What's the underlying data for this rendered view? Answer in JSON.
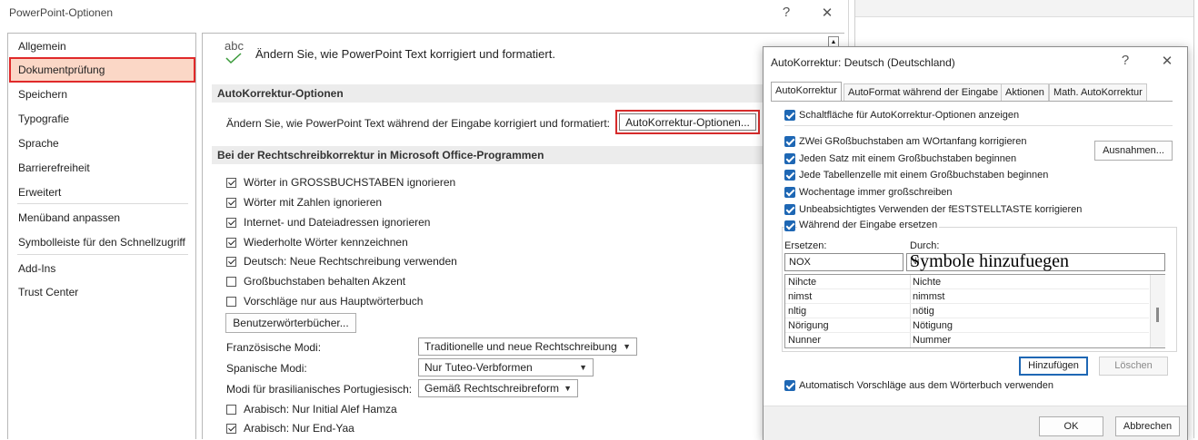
{
  "window": {
    "title": "PowerPoint-Optionen",
    "help_glyph": "?",
    "close_glyph": "✕"
  },
  "sidebar": {
    "items": [
      {
        "label": "Allgemein"
      },
      {
        "label": "Dokumentprüfung",
        "selected": true
      },
      {
        "label": "Speichern"
      },
      {
        "label": "Typografie"
      },
      {
        "label": "Sprache"
      },
      {
        "label": "Barrierefreiheit"
      },
      {
        "label": "Erweitert"
      },
      {
        "label": "Menüband anpassen"
      },
      {
        "label": "Symbolleiste für den Schnellzugriff"
      },
      {
        "label": "Add-Ins"
      },
      {
        "label": "Trust Center"
      }
    ]
  },
  "content": {
    "header_icon": "abc",
    "header_text": "Ändern Sie, wie PowerPoint Text korrigiert und formatiert.",
    "autocorrect_section": "AutoKorrektur-Optionen",
    "autocorrect_desc": "Ändern Sie, wie PowerPoint Text während der Eingabe korrigiert und formatiert:",
    "autocorrect_button": "AutoKorrektur-Optionen...",
    "spelling_section": "Bei der Rechtschreibkorrektur in Microsoft Office-Programmen",
    "options": [
      {
        "label": "Wörter in GROSSBUCHSTABEN ignorieren",
        "checked": true
      },
      {
        "label": "Wörter mit Zahlen ignorieren",
        "checked": true
      },
      {
        "label": "Internet- und Dateiadressen ignorieren",
        "checked": true
      },
      {
        "label": "Wiederholte Wörter kennzeichnen",
        "checked": true
      },
      {
        "label": "Deutsch: Neue Rechtschreibung verwenden",
        "checked": true
      },
      {
        "label": "Großbuchstaben behalten Akzent",
        "checked": false
      },
      {
        "label": "Vorschläge nur aus Hauptwörterbuch",
        "checked": false
      }
    ],
    "dictionaries_button": "Benutzerwörterbücher...",
    "modes": [
      {
        "label": "Französische Modi:",
        "value": "Traditionelle und neue Rechtschreibung"
      },
      {
        "label": "Spanische Modi:",
        "value": "Nur Tuteo-Verbformen"
      },
      {
        "label": "Modi für brasilianisches Portugiesisch:",
        "value": "Gemäß Rechtschreibreform"
      }
    ],
    "arabic_options": [
      {
        "label": "Arabisch: Nur Initial Alef Hamza",
        "checked": false
      },
      {
        "label": "Arabisch: Nur End-Yaa",
        "checked": true
      }
    ]
  },
  "dialog": {
    "title": "AutoKorrektur: Deutsch (Deutschland)",
    "help_glyph": "?",
    "close_glyph": "✕",
    "tabs": [
      {
        "label": "AutoKorrektur",
        "active": true
      },
      {
        "label": "AutoFormat während der Eingabe"
      },
      {
        "label": "Aktionen"
      },
      {
        "label": "Math. AutoKorrektur"
      }
    ],
    "show_buttons_option": "Schaltfläche für AutoKorrektur-Optionen anzeigen",
    "options": [
      "ZWei GRoßbuchstaben am WOrtanfang korrigieren",
      "Jeden Satz mit einem Großbuchstaben beginnen",
      "Jede Tabellenzelle mit einem Großbuchstaben beginnen",
      "Wochentage immer großschreiben",
      "Unbeabsichtigtes Verwenden der fESTSTELLTASTE korrigieren"
    ],
    "exceptions_button": "Ausnahmen...",
    "replace_while_typing": "Während der Eingabe ersetzen",
    "replace_label": "Ersetzen:",
    "with_label": "Durch:",
    "replace_value": "NOX",
    "with_value": "Symbole hinzufuegen",
    "with_prefix": "Ni",
    "rows": [
      {
        "from": "Nihcte",
        "to": "Nichte"
      },
      {
        "from": "nimst",
        "to": "nimmst"
      },
      {
        "from": "nltig",
        "to": "nötig"
      },
      {
        "from": "Nörigung",
        "to": "Nötigung"
      },
      {
        "from": "Nunner",
        "to": "Nummer"
      }
    ],
    "add_button": "Hinzufügen",
    "delete_button": "Löschen",
    "suggestions_option": "Automatisch Vorschläge aus dem Wörterbuch verwenden",
    "ok_button": "OK",
    "cancel_button": "Abbrechen"
  }
}
